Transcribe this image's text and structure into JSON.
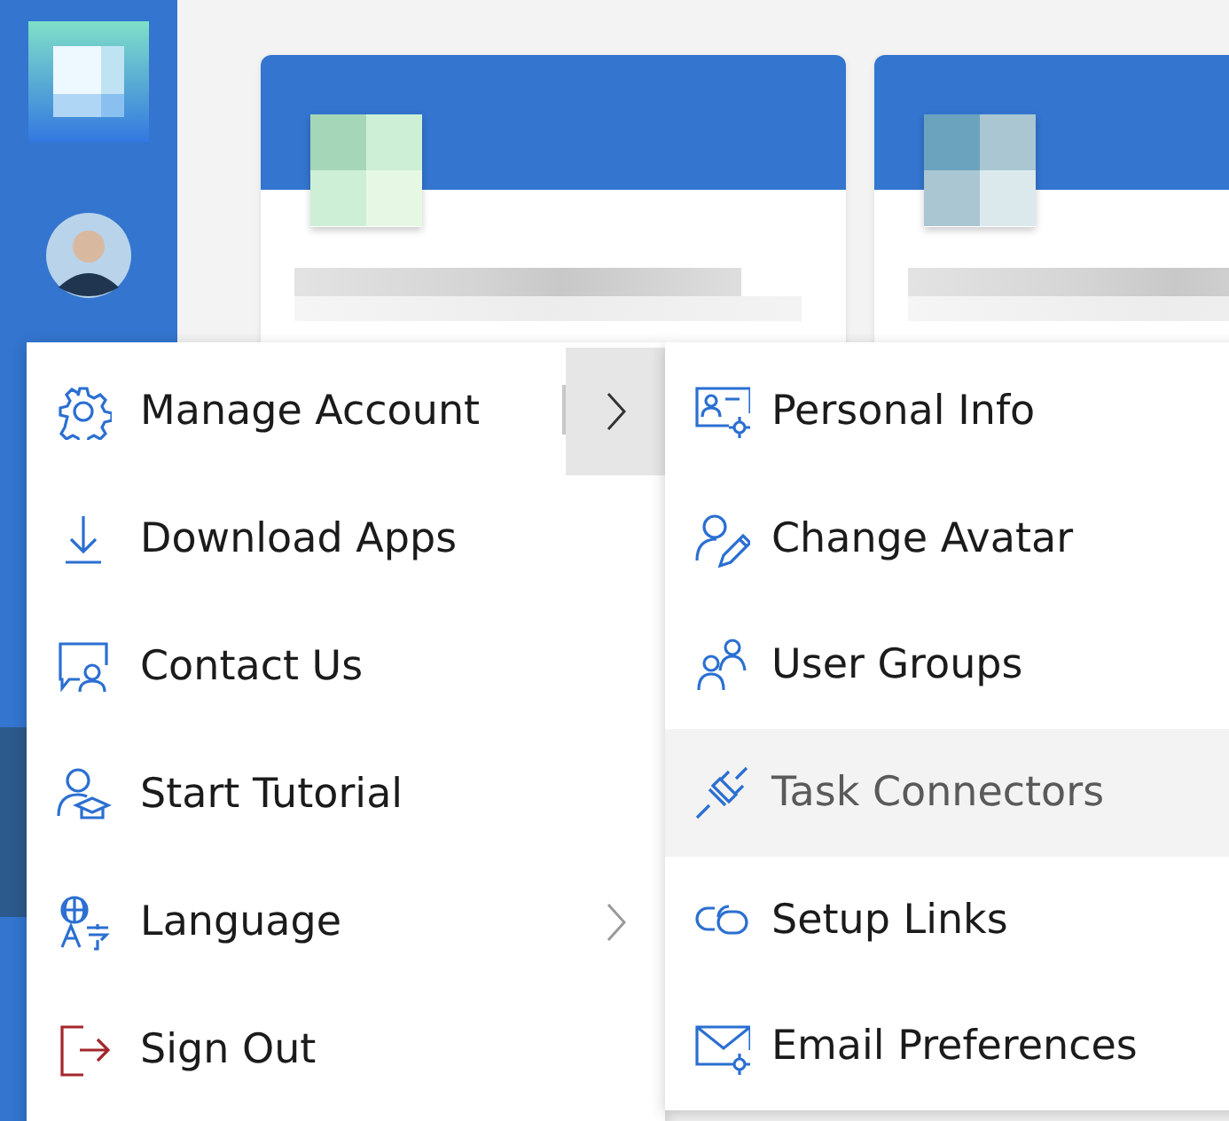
{
  "menu": {
    "items": [
      {
        "label": "Manage Account",
        "submenu": true,
        "expanded": true
      },
      {
        "label": "Download Apps",
        "submenu": false,
        "expanded": false
      },
      {
        "label": "Contact Us",
        "submenu": false,
        "expanded": false
      },
      {
        "label": "Start Tutorial",
        "submenu": false,
        "expanded": false
      },
      {
        "label": "Language",
        "submenu": true,
        "expanded": false
      },
      {
        "label": "Sign Out",
        "submenu": false,
        "expanded": false
      }
    ]
  },
  "submenu": {
    "items": [
      {
        "label": "Personal Info",
        "highlighted": false
      },
      {
        "label": "Change Avatar",
        "highlighted": false
      },
      {
        "label": "User Groups",
        "highlighted": false
      },
      {
        "label": "Task Connectors",
        "highlighted": true
      },
      {
        "label": "Setup Links",
        "highlighted": false
      },
      {
        "label": "Email Preferences",
        "highlighted": false
      }
    ]
  }
}
